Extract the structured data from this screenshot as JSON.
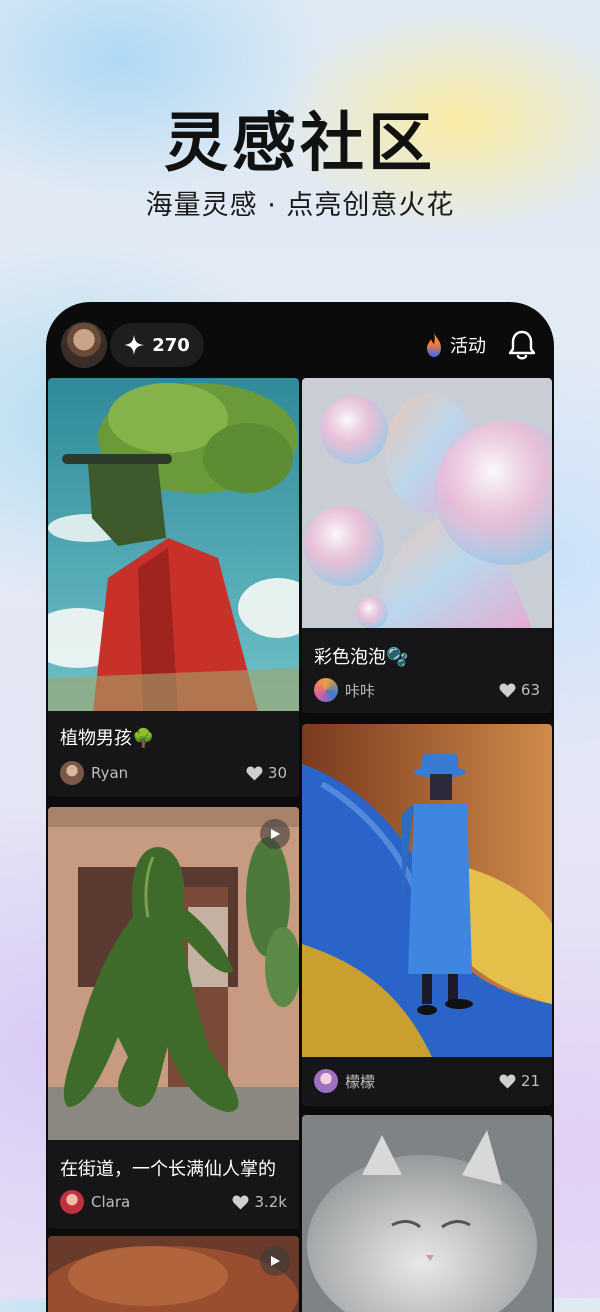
{
  "hero": {
    "title": "灵感社区",
    "subtitle": "海量灵感 · 点亮创意火花"
  },
  "topbar": {
    "credits": "270",
    "activity_label": "活动"
  },
  "feed": [
    {
      "title": "植物男孩🌳",
      "author": "Ryan",
      "likes": "30"
    },
    {
      "title": "彩色泡泡🫧",
      "author": "咔咔",
      "likes": "63"
    },
    {
      "title": "在街道，一个长满仙人掌的",
      "author": "Clara",
      "likes": "3.2k"
    },
    {
      "title": "",
      "author": "檬檬",
      "likes": "21"
    }
  ],
  "colors": {
    "background": "#e4eaf5",
    "panel": "#0b0b0c",
    "card": "#161618",
    "flame": "#3b7bff"
  },
  "icons": [
    "sparkle-icon",
    "flame-icon",
    "bell-icon",
    "heart-icon",
    "play-icon"
  ]
}
